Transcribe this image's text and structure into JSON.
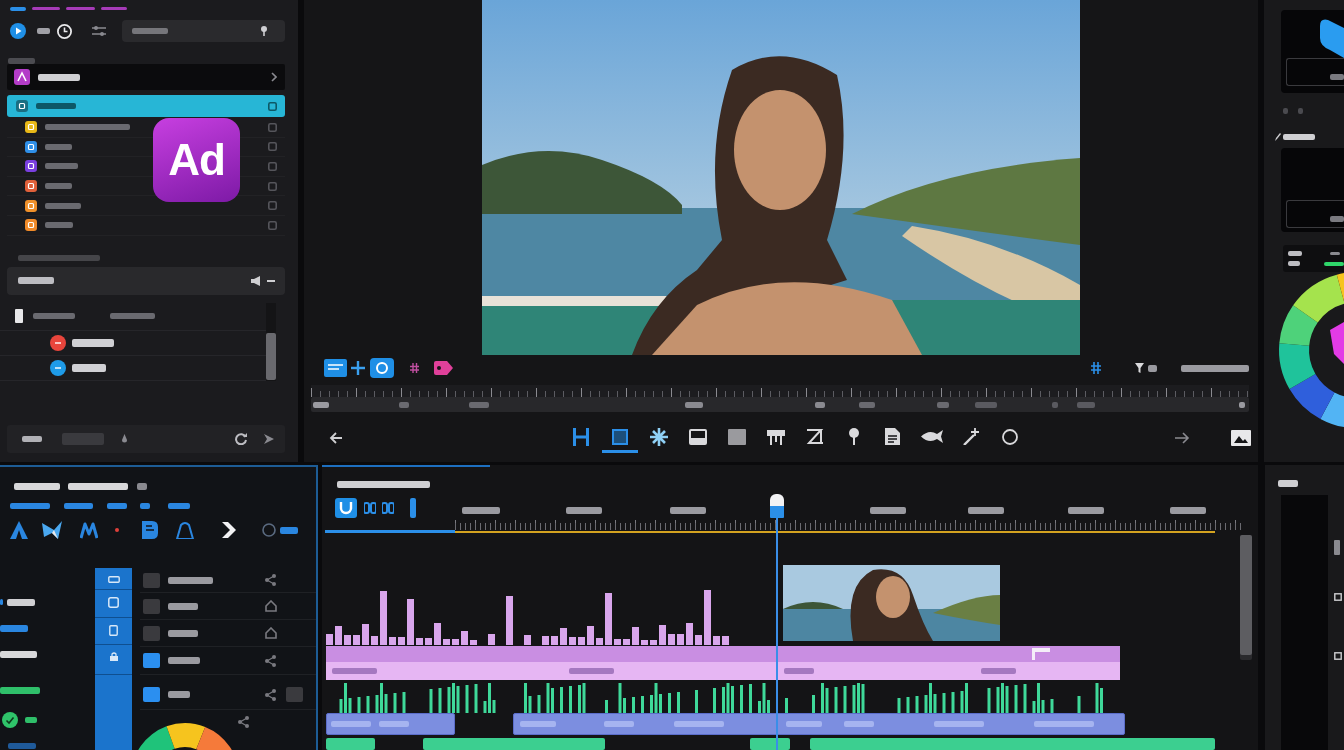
{
  "tabs": [
    {
      "selected": true
    },
    {
      "selected": false
    },
    {
      "selected": false
    },
    {
      "selected": false
    }
  ],
  "media": {
    "header": {
      "color": "#b43cc8"
    },
    "items": [
      {
        "color": "#1a6e82",
        "selected": true
      },
      {
        "color": "#e8b818",
        "selected": false
      },
      {
        "color": "#2f8fe8",
        "selected": false
      },
      {
        "color": "#7a3fe0",
        "selected": false
      },
      {
        "color": "#e0603a",
        "selected": false
      },
      {
        "color": "#f0902a",
        "selected": false
      },
      {
        "color": "#f08a28",
        "selected": false
      }
    ]
  },
  "logo": {
    "text": "Ad"
  },
  "layers": [
    {
      "color": "#e8453c"
    },
    {
      "color": "#1e9be8"
    }
  ],
  "tools": [
    {
      "selected": false
    },
    {
      "selected": true
    },
    {
      "selected": false
    },
    {
      "selected": false
    },
    {
      "selected": false
    },
    {
      "selected": false
    },
    {
      "selected": false
    },
    {
      "selected": false
    },
    {
      "selected": false
    },
    {
      "selected": false
    },
    {
      "selected": false
    },
    {
      "selected": false
    }
  ],
  "effects": [
    {
      "checked": false
    },
    {
      "checked": false
    },
    {
      "checked": false
    },
    {
      "checked": true
    },
    {
      "checked": true
    }
  ],
  "timeline": {
    "playhead": {
      "level": 0.408
    }
  }
}
